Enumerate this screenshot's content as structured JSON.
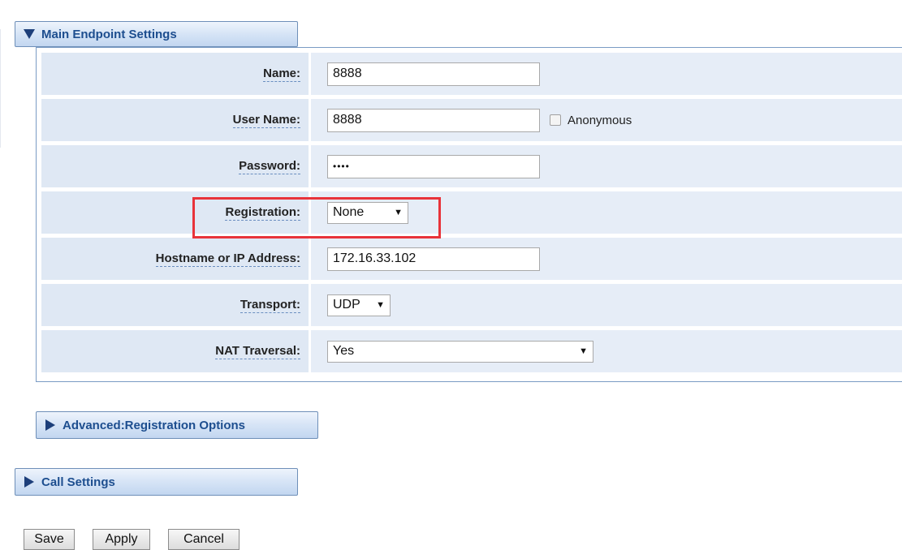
{
  "sections": {
    "main": "Main Endpoint Settings",
    "advanced": "Advanced:Registration Options",
    "call": "Call Settings"
  },
  "form": {
    "name": {
      "label": "Name:",
      "value": "8888"
    },
    "user_name": {
      "label": "User Name:",
      "value": "8888",
      "checkbox_label": "Anonymous",
      "checked": false
    },
    "password": {
      "label": "Password:",
      "value": "••••"
    },
    "registration": {
      "label": "Registration:",
      "selected": "None"
    },
    "hostname": {
      "label": "Hostname or IP Address:",
      "value": "172.16.33.102"
    },
    "transport": {
      "label": "Transport:",
      "selected": "UDP"
    },
    "nat_traversal": {
      "label": "NAT Traversal:",
      "selected": "Yes"
    }
  },
  "actions": {
    "save": "Save",
    "apply": "Apply",
    "cancel": "Cancel"
  },
  "colors": {
    "section_text": "#1d4e8f",
    "highlight": "#e8333a",
    "label_bg": "#dfe8f4",
    "value_bg": "#e6edf7"
  },
  "icons": {
    "expanded": "triangle-down-icon",
    "collapsed": "triangle-right-icon",
    "select_arrow": "caret-down-icon"
  }
}
